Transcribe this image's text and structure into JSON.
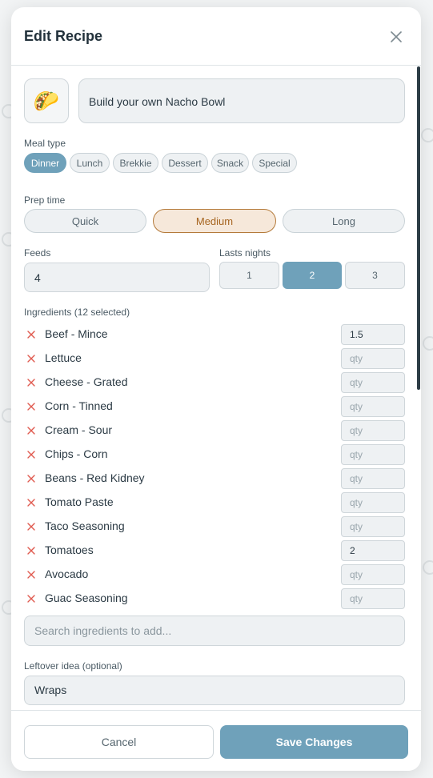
{
  "modal": {
    "title": "Edit Recipe",
    "close_icon": "close-icon"
  },
  "recipe": {
    "icon": "🌮",
    "icon_name": "taco-icon",
    "name": "Build your own Nacho Bowl"
  },
  "meal_type": {
    "label": "Meal type",
    "options": [
      "Dinner",
      "Lunch",
      "Brekkie",
      "Dessert",
      "Snack",
      "Special"
    ],
    "selected": "Dinner"
  },
  "prep_time": {
    "label": "Prep time",
    "options": [
      "Quick",
      "Medium",
      "Long"
    ],
    "selected": "Medium"
  },
  "feeds": {
    "label": "Feeds",
    "value": "4"
  },
  "lasts_nights": {
    "label": "Lasts nights",
    "options": [
      "1",
      "2",
      "3"
    ],
    "selected": "2"
  },
  "ingredients": {
    "label": "Ingredients (12 selected)",
    "qty_placeholder": "qty",
    "items": [
      {
        "name": "Beef - Mince",
        "qty": "1.5"
      },
      {
        "name": "Lettuce",
        "qty": ""
      },
      {
        "name": "Cheese - Grated",
        "qty": ""
      },
      {
        "name": "Corn - Tinned",
        "qty": ""
      },
      {
        "name": "Cream - Sour",
        "qty": ""
      },
      {
        "name": "Chips - Corn",
        "qty": ""
      },
      {
        "name": "Beans - Red Kidney",
        "qty": ""
      },
      {
        "name": "Tomato Paste",
        "qty": ""
      },
      {
        "name": "Taco Seasoning",
        "qty": ""
      },
      {
        "name": "Tomatoes",
        "qty": "2"
      },
      {
        "name": "Avocado",
        "qty": ""
      },
      {
        "name": "Guac Seasoning",
        "qty": ""
      }
    ]
  },
  "search": {
    "placeholder": "Search ingredients to add..."
  },
  "leftover": {
    "label": "Leftover idea (optional)",
    "value": "Wraps"
  },
  "footer": {
    "cancel_label": "Cancel",
    "save_label": "Save Changes"
  },
  "colors": {
    "accent": "#6fa1ba",
    "prep_selected_bg": "#f6e8da",
    "prep_selected_border": "#b47a3a",
    "remove_x": "#e05a4f"
  }
}
